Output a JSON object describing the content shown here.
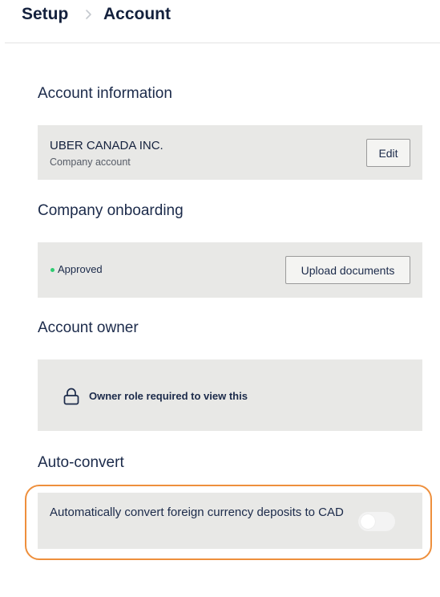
{
  "breadcrumb": {
    "parent": "Setup",
    "current": "Account"
  },
  "sections": {
    "account_information": {
      "title": "Account information",
      "company_name": "UBER CANADA INC.",
      "company_type": "Company account",
      "edit_label": "Edit"
    },
    "company_onboarding": {
      "title": "Company onboarding",
      "status": "Approved",
      "status_color": "#2ecc71",
      "upload_label": "Upload documents"
    },
    "account_owner": {
      "title": "Account owner",
      "locked_message": "Owner role required to view this",
      "icon": "lock-icon"
    },
    "auto_convert": {
      "title": "Auto-convert",
      "description": "Automatically convert foreign currency deposits to CAD",
      "enabled": false
    }
  },
  "colors": {
    "highlight": "#ee8f3c",
    "card_bg": "#e8e8e6",
    "text": "#1b2a4a"
  }
}
